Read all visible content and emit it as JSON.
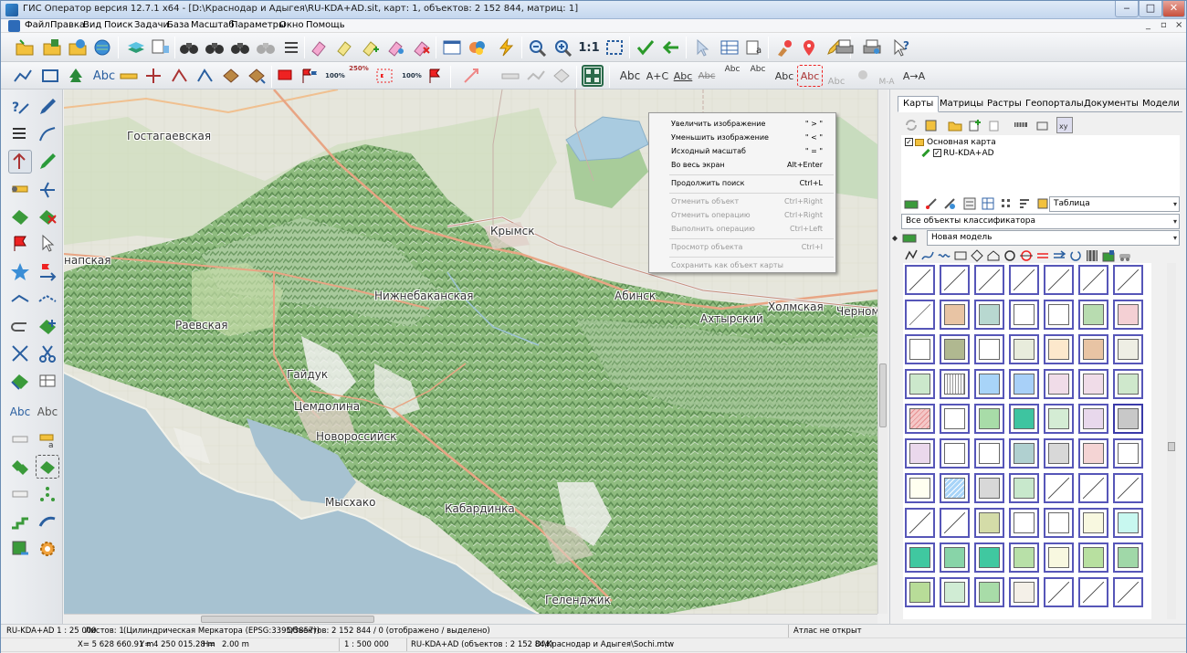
{
  "window": {
    "title": "ГИС Оператор версия 12.7.1 x64 - [D:\\Краснодар и Адыгея\\RU-KDA+AD.sit, карт: 1, объектов: 2 152 844, матриц: 1]",
    "minimize": "‒",
    "maximize": "□",
    "close": "✕"
  },
  "menu": {
    "items": [
      "Файл",
      "Правка",
      "Вид",
      "Поиск",
      "Задачи",
      "База",
      "Масштаб",
      "Параметры",
      "Окно",
      "Помощь"
    ],
    "mdi_buttons": [
      "_",
      "▫",
      "×"
    ]
  },
  "toolbar": {
    "scale_1to1": "1:1",
    "abc_labels": [
      "Abc",
      "A+C",
      "Abc",
      "Abc",
      "Abc",
      "Abc",
      "Abc",
      "Abc",
      "Abc",
      "M-A",
      "A→A"
    ],
    "pct_labels": [
      "100%",
      "250%",
      "100%"
    ],
    "text_label": "Abc"
  },
  "lefttools": {
    "abc_labels": [
      "Abc",
      "Abc"
    ]
  },
  "map": {
    "cities": [
      {
        "name": "Гостагаевская"
      },
      {
        "name": "Крымск"
      },
      {
        "name": "напская"
      },
      {
        "name": "Нижнебаканская"
      },
      {
        "name": "Абинск"
      },
      {
        "name": "Холмская"
      },
      {
        "name": "Ахтырский"
      },
      {
        "name": "Черномо"
      },
      {
        "name": "Раевская"
      },
      {
        "name": "Гайдук"
      },
      {
        "name": "Цемдолина"
      },
      {
        "name": "Новороссийск"
      },
      {
        "name": "Мысхако"
      },
      {
        "name": "Кабардинка"
      },
      {
        "name": "Геленджик"
      }
    ]
  },
  "context_menu": {
    "items": [
      {
        "label": "Увеличить изображение",
        "shortcut": "\" > \"",
        "disabled": false
      },
      {
        "label": "Уменьшить изображение",
        "shortcut": "\" < \"",
        "disabled": false
      },
      {
        "label": "Исходный масштаб",
        "shortcut": "\" = \"",
        "disabled": false
      },
      {
        "label": "Во весь экран",
        "shortcut": "Alt+Enter",
        "disabled": false
      },
      {
        "label": "Продолжить поиск",
        "shortcut": "Ctrl+L",
        "disabled": false
      },
      {
        "label": "Отменить объект",
        "shortcut": "Ctrl+Right",
        "disabled": true
      },
      {
        "label": "Отменить операцию",
        "shortcut": "Ctrl+Right",
        "disabled": true
      },
      {
        "label": "Выполнить операцию",
        "shortcut": "Ctrl+Left",
        "disabled": true
      },
      {
        "label": "Просмотр объекта",
        "shortcut": "Ctrl+I",
        "disabled": true
      },
      {
        "label": "Сохранить как объект карты",
        "shortcut": "",
        "disabled": true
      }
    ]
  },
  "right_panel": {
    "tabs": [
      "Карты",
      "Матрицы",
      "Растры",
      "Геопорталы",
      "Документы",
      "Модели"
    ],
    "active_tab": "Карты",
    "tree": {
      "root": "Основная карта",
      "child": "RU-KDA+AD"
    },
    "view_select": "Таблица",
    "classifier_select": "Все объекты классификатора",
    "model_select": "Новая модель",
    "swatch_colors": [
      [
        "#ffffff",
        "#ffffff",
        "#ffffff",
        "#ffffff",
        "#ffffff",
        "#ffffff",
        "#ffffff"
      ],
      [
        "#ffffff",
        "#e8c4a4",
        "#b8d8d0",
        "#ffffff",
        "#ffffff",
        "#b8dcb0",
        "#f4d0d4"
      ],
      [
        "#ffffff",
        "#b0b890",
        "#ffffff",
        "#e8ecdc",
        "#fce8cc",
        "#e8c4a4",
        "#eeeee4"
      ],
      [
        "#cce8cc",
        "#f4f4f4",
        "#a8d4f8",
        "#a8d0f8",
        "#f0dce8",
        "#f0dce8",
        "#cfe8cc"
      ],
      [
        "#f4c8c8",
        "#ffffff",
        "#a8dca8",
        "#3ec4a0",
        "#d4ecd4",
        "#e8d8ec",
        "#c8c8c8"
      ],
      [
        "#ead8ec",
        "#ffffff",
        "#ffffff",
        "#b0d0d0",
        "#d8d8d8",
        "#f4d4d4",
        "#ffffff"
      ],
      [
        "#fffff0",
        "#a8d4f8",
        "#d8d8d8",
        "#c8e8cc",
        "#d4ecd8",
        "#f4f8a8",
        "#c8ecc8"
      ],
      [
        "#ffffff",
        "#ffffff",
        "#d4dca8",
        "#ffffff",
        "#ffffff",
        "#f8f8e0",
        "#c8f8f0"
      ],
      [
        "#40c8a0",
        "#88d4a8",
        "#40c8a0",
        "#b8e0a8",
        "#f8f8e0",
        "#b8e0a0",
        "#a0d8a8"
      ],
      [
        "#b8dc98",
        "#d0ecd4",
        "#a8dca8",
        "#f4f0e8",
        "#ffffff",
        "#ffffff",
        "#ffffff"
      ]
    ]
  },
  "status": {
    "row1": {
      "map": "RU-KDA+AD  1 : 25 000",
      "sheets": "Листов: 1",
      "projection": "(Цилиндрическая Меркатора (EPSG:3395/3857))",
      "objects": "Объектов: 2 152 844 / 0  (отображено / выделено)",
      "atlas": "Атлас не открыт"
    },
    "row2": {
      "x": "X=  5 628 660.91 m",
      "y": "Y= 4 250 015.28 m",
      "h": "H=",
      "h_value": "2.00 m",
      "scale": "1 : 500 000",
      "map_info": "RU-KDA+AD   (объектов : 2 152 844)",
      "matrix": "D:\\Краснодар и Адыгея\\Sochi.mtw"
    }
  }
}
